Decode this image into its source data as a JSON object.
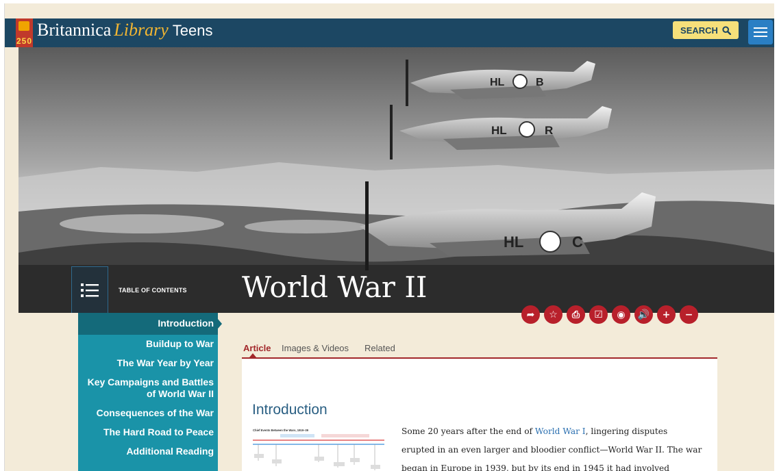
{
  "header": {
    "logo_number": "250",
    "brand_main": "Britannica",
    "brand_library": "Library",
    "brand_teens": "Teens",
    "search_label": "SEARCH",
    "search_icon": "search-icon",
    "menu_icon": "hamburger-menu-icon"
  },
  "hero": {
    "title": "World War II",
    "toc_label": "TABLE OF CONTENTS",
    "aircraft_codes": [
      "HL B",
      "HL R",
      "HL C"
    ]
  },
  "actions": [
    {
      "name": "share-icon",
      "glyph": "➦"
    },
    {
      "name": "favorite-icon",
      "glyph": "☆"
    },
    {
      "name": "print-icon",
      "glyph": "⎙"
    },
    {
      "name": "cite-icon",
      "glyph": "☑"
    },
    {
      "name": "translate-icon",
      "glyph": "◉"
    },
    {
      "name": "read-aloud-icon",
      "glyph": "🔊"
    },
    {
      "name": "increase-font-icon",
      "glyph": "+"
    },
    {
      "name": "decrease-font-icon",
      "glyph": "−"
    }
  ],
  "toc": {
    "items": [
      {
        "label": "Introduction",
        "active": true
      },
      {
        "label": "Buildup to War"
      },
      {
        "label": "The War Year by Year"
      },
      {
        "label": "Key Campaigns and Battles of World War II"
      },
      {
        "label": "Consequences of the War"
      },
      {
        "label": "The Hard Road to Peace"
      },
      {
        "label": "Additional Reading"
      }
    ]
  },
  "tabs": {
    "article": "Article",
    "images_videos": "Images & Videos",
    "related": "Related"
  },
  "content": {
    "section_heading": "Introduction",
    "thumbnail_title": "Chief Events Between the Wars, 1919–39",
    "p1_before_link": "Some 20 years after the end of ",
    "p1_link": "World War I",
    "p1_after_link": ", lingering disputes erupted in an even larger and bloodier conflict—World War II. The war began in Europe in 1939, but by its end in 1945 it had involved"
  },
  "colors": {
    "header_bg": "#1c4763",
    "accent_red": "#b8202b",
    "toc_teal": "#1a93a8",
    "page_cream": "#f3ebd9"
  }
}
